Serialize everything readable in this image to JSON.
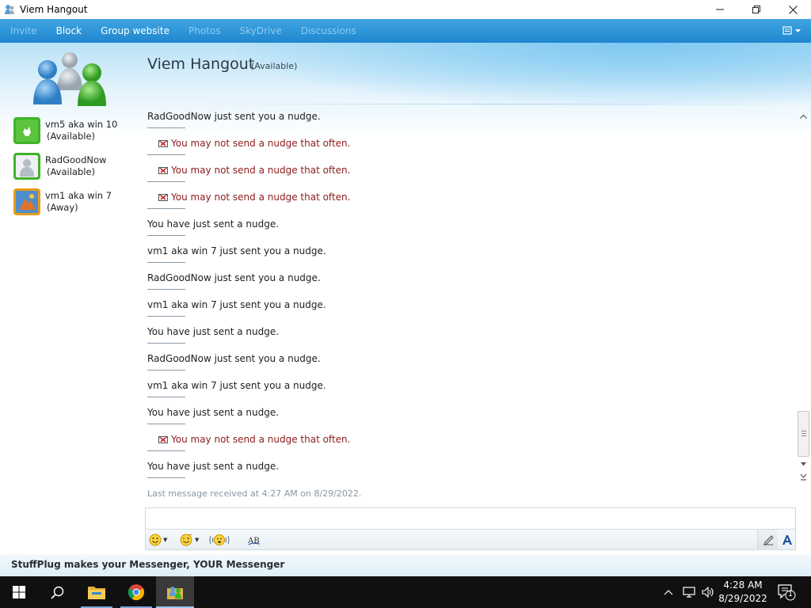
{
  "window": {
    "title": "Viem Hangout",
    "controls": {
      "minimize": "—",
      "restore": "❐",
      "close": "✕"
    }
  },
  "menu": {
    "items": [
      {
        "label": "Invite",
        "enabled": false
      },
      {
        "label": "Block",
        "enabled": true
      },
      {
        "label": "Group website",
        "enabled": true
      },
      {
        "label": "Photos",
        "enabled": false
      },
      {
        "label": "SkyDrive",
        "enabled": false
      },
      {
        "label": "Discussions",
        "enabled": false
      }
    ],
    "options_icon": "options-menu-icon"
  },
  "contacts": [
    {
      "name": "vm5 aka win 10",
      "status": "(Available)",
      "color": "#3db42a"
    },
    {
      "name": "RadGoodNow",
      "status": "(Available)",
      "color": "#3db42a"
    },
    {
      "name": "vm1 aka win 7",
      "status": "(Away)",
      "color": "#e89a1a"
    }
  ],
  "conversation": {
    "title": "Viem Hangout",
    "status": "(Available)",
    "messages": [
      {
        "text": "RadGoodNow just sent you a nudge.",
        "type": "normal"
      },
      {
        "text": "You may not send a nudge that often.",
        "type": "warning"
      },
      {
        "text": "You may not send a nudge that often.",
        "type": "warning"
      },
      {
        "text": "You may not send a nudge that often.",
        "type": "warning"
      },
      {
        "text": "You have just sent a nudge.",
        "type": "normal"
      },
      {
        "text": "vm1 aka win 7 just sent you a nudge.",
        "type": "normal"
      },
      {
        "text": "RadGoodNow just sent you a nudge.",
        "type": "normal"
      },
      {
        "text": "vm1 aka win 7 just sent you a nudge.",
        "type": "normal"
      },
      {
        "text": "You have just sent a nudge.",
        "type": "normal"
      },
      {
        "text": "RadGoodNow just sent you a nudge.",
        "type": "normal"
      },
      {
        "text": "vm1 aka win 7 just sent you a nudge.",
        "type": "normal"
      },
      {
        "text": "You have just sent a nudge.",
        "type": "normal"
      },
      {
        "text": "You may not send a nudge that often.",
        "type": "warning"
      },
      {
        "text": "You have just sent a nudge.",
        "type": "normal"
      }
    ],
    "last_message": "Last message received at 4:27 AM on 8/29/2022."
  },
  "input": {
    "value": "",
    "toolbar": [
      "emoticon-icon",
      "wink-icon",
      "nudge-icon",
      "spellcheck-icon",
      "handwriting-icon",
      "font-icon"
    ]
  },
  "footer": {
    "text": "StuffPlug makes your Messenger, YOUR Messenger"
  },
  "taskbar": {
    "clock_time": "4:28 AM",
    "clock_date": "8/29/2022",
    "notification_count": "1"
  },
  "colors": {
    "menubar": "#1f87d0",
    "warning_text": "#8a1c1c",
    "available": "#3db42a",
    "away": "#e89a1a"
  }
}
